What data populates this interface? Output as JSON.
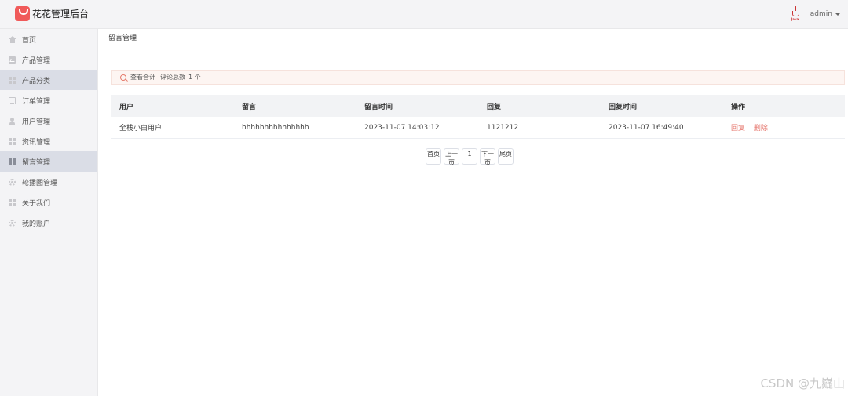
{
  "header": {
    "title": "花花管理后台",
    "username": "admin",
    "avatar_text": "Java"
  },
  "sidebar": {
    "items": [
      {
        "label": "首页",
        "icon": "home-icon",
        "active": false
      },
      {
        "label": "产品管理",
        "icon": "chart-icon",
        "active": false
      },
      {
        "label": "产品分类",
        "icon": "grid-icon",
        "active": true
      },
      {
        "label": "订单管理",
        "icon": "document-icon",
        "active": false
      },
      {
        "label": "用户管理",
        "icon": "user-icon",
        "active": false
      },
      {
        "label": "资讯管理",
        "icon": "grid-icon",
        "active": false
      },
      {
        "label": "留言管理",
        "icon": "grid-icon",
        "active": true
      },
      {
        "label": "轮播图管理",
        "icon": "gear-icon",
        "active": false
      },
      {
        "label": "关于我们",
        "icon": "grid-icon",
        "active": false
      },
      {
        "label": "我的账户",
        "icon": "gear-icon",
        "active": false
      }
    ]
  },
  "breadcrumb": "留言管理",
  "stats": {
    "label": "查看合计",
    "count_label": "评论总数",
    "count_value": "1 个"
  },
  "table": {
    "headers": [
      "用户",
      "留言",
      "留言时间",
      "回复",
      "回复时间",
      "操作"
    ],
    "rows": [
      {
        "user": "全栈小白用户",
        "message": "hhhhhhhhhhhhhhh",
        "message_time": "2023-11-07 14:03:12",
        "reply": "1121212",
        "reply_time": "2023-11-07 16:49:40",
        "actions": [
          "回复",
          "删除"
        ]
      }
    ]
  },
  "pagination": {
    "first": "首页",
    "prev_line1": "上一",
    "prev_line2": "页",
    "current": "1",
    "next_line1": "下一",
    "next_line2": "页",
    "last": "尾页"
  },
  "watermark": "CSDN @九嶷山",
  "colors": {
    "accent": "#f05a5a",
    "action": "#e5736a",
    "sidebar_bg": "#f4f4f6",
    "active_bg": "#dadde6"
  }
}
